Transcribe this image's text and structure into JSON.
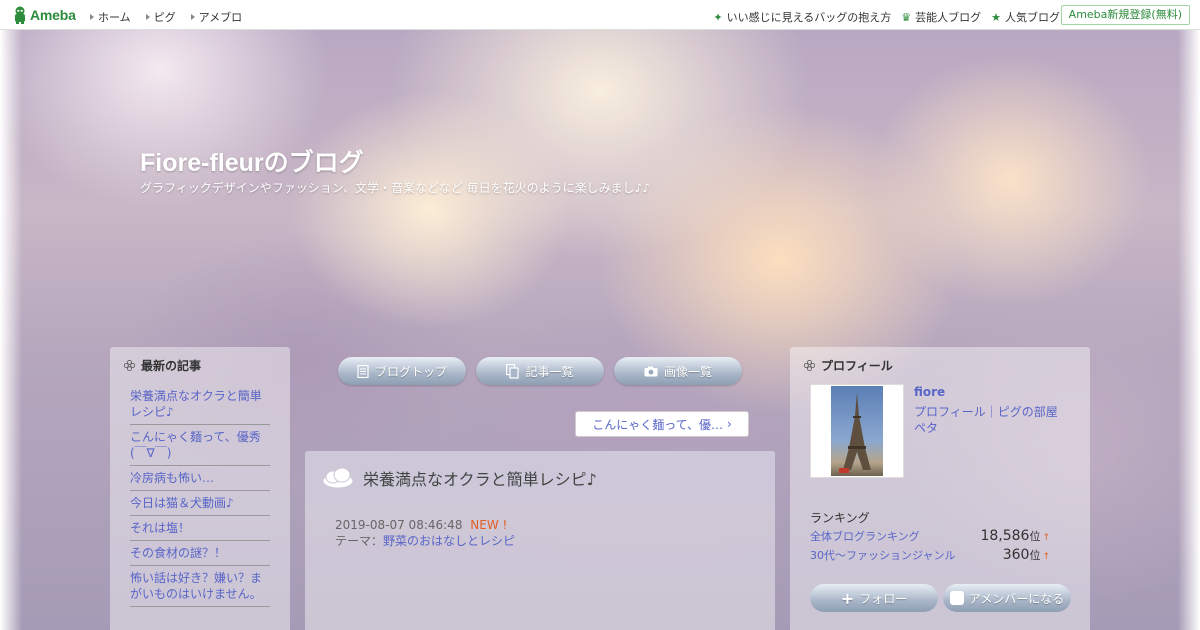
{
  "header": {
    "logo_text": "Ameba",
    "left_nav": [
      "ホーム",
      "ピグ",
      "アメブロ"
    ],
    "right_nav": [
      {
        "label": "いい感じに見えるバッグの抱え方",
        "icon": "sparkle-icon"
      },
      {
        "label": "芸能人ブログ",
        "icon": "crown-icon"
      },
      {
        "label": "人気ブログ",
        "icon": "star-icon"
      }
    ],
    "register_label": "Ameba新規登録(無料)"
  },
  "blog": {
    "title": "Fiore-fleurのブログ",
    "description": "グラフィックデザインやファッション、文学・音楽などなど 毎日を花火のように楽しみまし♪♪"
  },
  "left_sidebar": {
    "heading": "最新の記事",
    "items": [
      "栄養満点なオクラと簡単レシピ♪",
      "こんにゃく麺って、優秀(￣∇￣)",
      "冷房病も怖い…",
      "今日は猫＆犬動画♪",
      "それは塩！",
      "その食材の謎？！",
      "怖い話は好き？嫌い？まがいものはいけません。"
    ]
  },
  "nav_buttons": [
    {
      "label": "ブログトップ",
      "icon": "document-icon"
    },
    {
      "label": "記事一覧",
      "icon": "copy-icon"
    },
    {
      "label": "画像一覧",
      "icon": "camera-icon"
    }
  ],
  "prev_article_label": "こんにゃく麺って、優…",
  "article": {
    "title": "栄養満点なオクラと簡単レシピ♪",
    "date": "2019-08-07 08:46:48",
    "new_label": "NEW !",
    "theme_prefix": "テーマ：",
    "theme": "野菜のおはなしとレシピ"
  },
  "profile": {
    "heading": "プロフィール",
    "name": "fiore",
    "links": [
      "プロフィール",
      "ピグの部屋",
      "ペタ"
    ],
    "ranking_title": "ランキング",
    "rankings": [
      {
        "label": "全体ブログランキング",
        "value": "18,586",
        "unit": "位",
        "trend": "↑"
      },
      {
        "label": "30代〜ファッションジャンル",
        "value": "360",
        "unit": "位",
        "trend": "↑"
      }
    ],
    "follow_label": "フォロー",
    "member_label": "アメンバーになる"
  },
  "colors": {
    "link": "#5965c8",
    "ameba_green": "#2d8c3c",
    "new": "#e35e24"
  }
}
